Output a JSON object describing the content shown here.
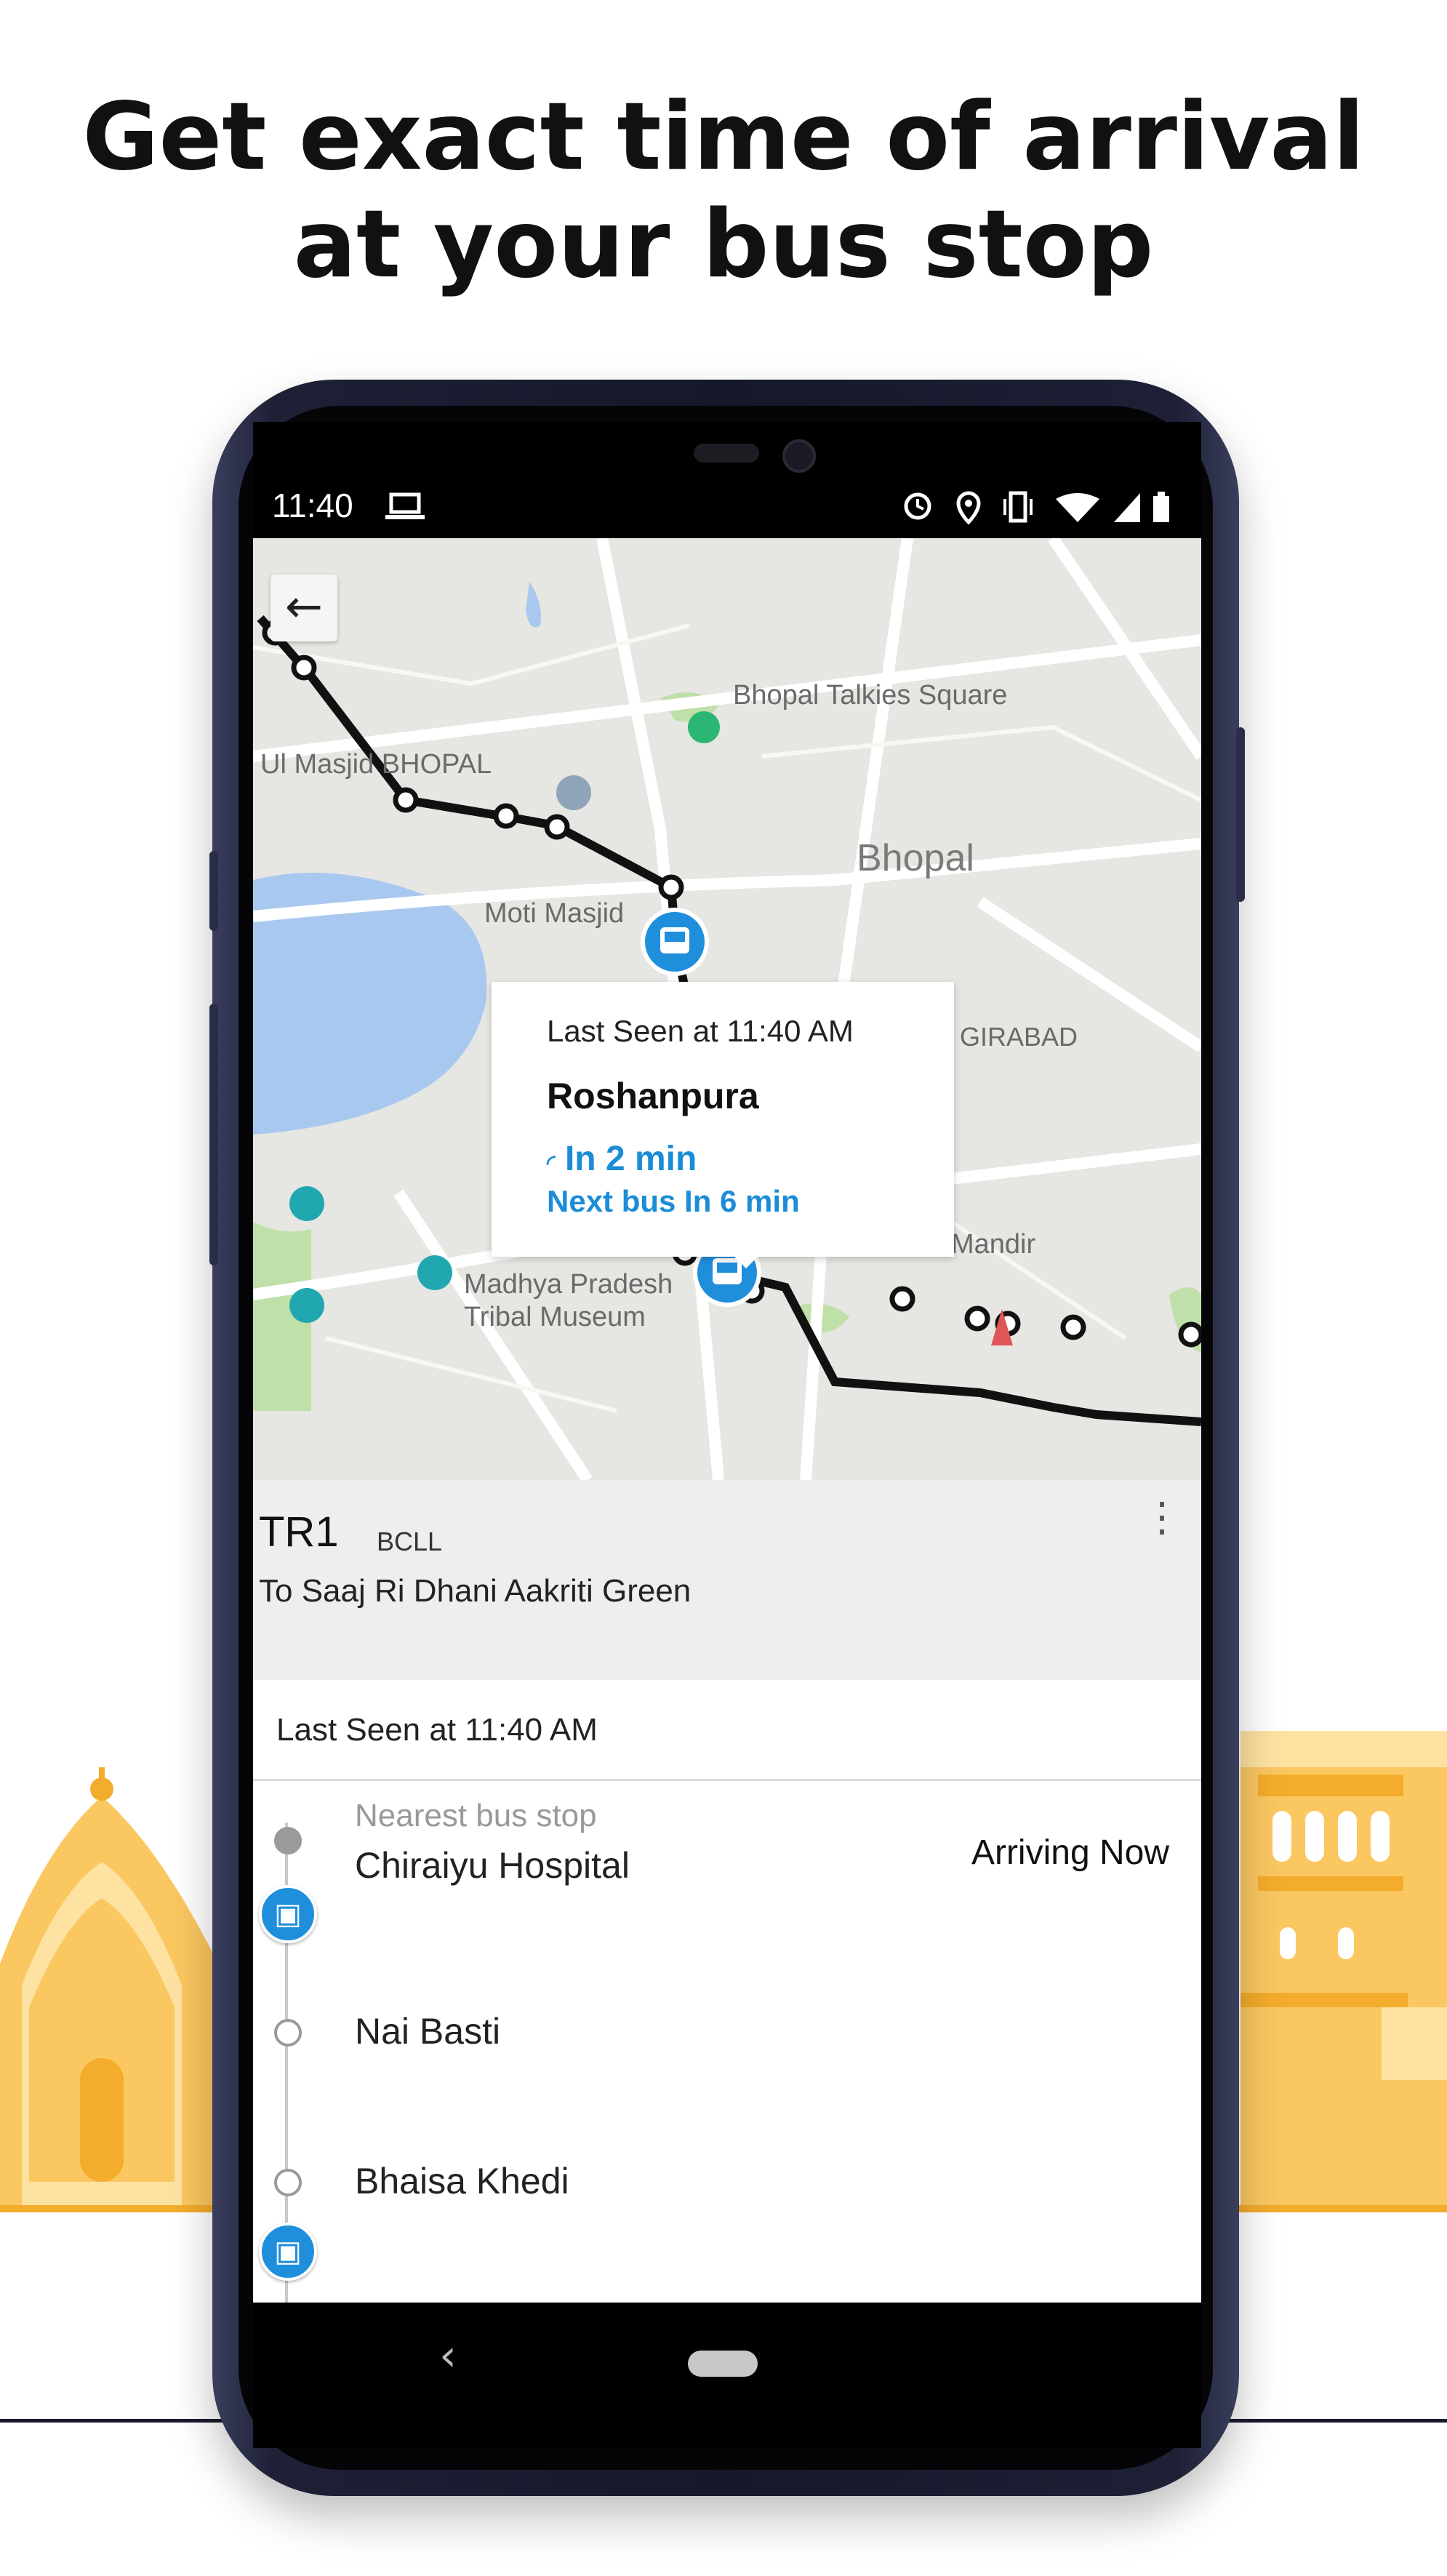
{
  "headline": {
    "line1": "Get exact time of arrival",
    "line2": "at your bus stop"
  },
  "statusbar": {
    "time": "11:40",
    "icons": [
      "laptop-icon",
      "alarm-icon",
      "location-icon",
      "vibrate-icon",
      "wifi-icon",
      "signal-icon",
      "battery-icon"
    ]
  },
  "map": {
    "back_icon": "←",
    "labels": {
      "bhopal_talkies": "Bhopal Talkies Square",
      "masjid": "Ul Masjid BHOPAL",
      "bhopal": "Bhopal",
      "moti_masjid": "Moti Masjid",
      "girabad": "GIRABAD",
      "mandir": "Mandir",
      "tribal_museum_1": "Madhya Pradesh",
      "tribal_museum_2": "Tribal Museum"
    },
    "popup": {
      "last_seen": "Last Seen at 11:40 AM",
      "stop": "Roshanpura",
      "eta": "In 2 min",
      "next_bus": "Next bus In 6 min"
    },
    "colors": {
      "route": "#111111",
      "bus": "#1f8fdc",
      "water": "#a8c8f0",
      "park": "#bfe0a8"
    }
  },
  "route": {
    "number": "TR1",
    "operator": "BCLL",
    "destination": "To Saaj Ri Dhani Aakriti Green"
  },
  "list": {
    "last_seen": "Last Seen at 11:40 AM",
    "nearest_label": "Nearest bus stop",
    "stops": [
      {
        "name": "Chiraiyu Hospital",
        "status": "Arriving Now"
      },
      {
        "name": "Nai Basti",
        "status": ""
      },
      {
        "name": "Bhaisa Khedi",
        "status": ""
      }
    ]
  },
  "navbar": {
    "back": "‹"
  }
}
